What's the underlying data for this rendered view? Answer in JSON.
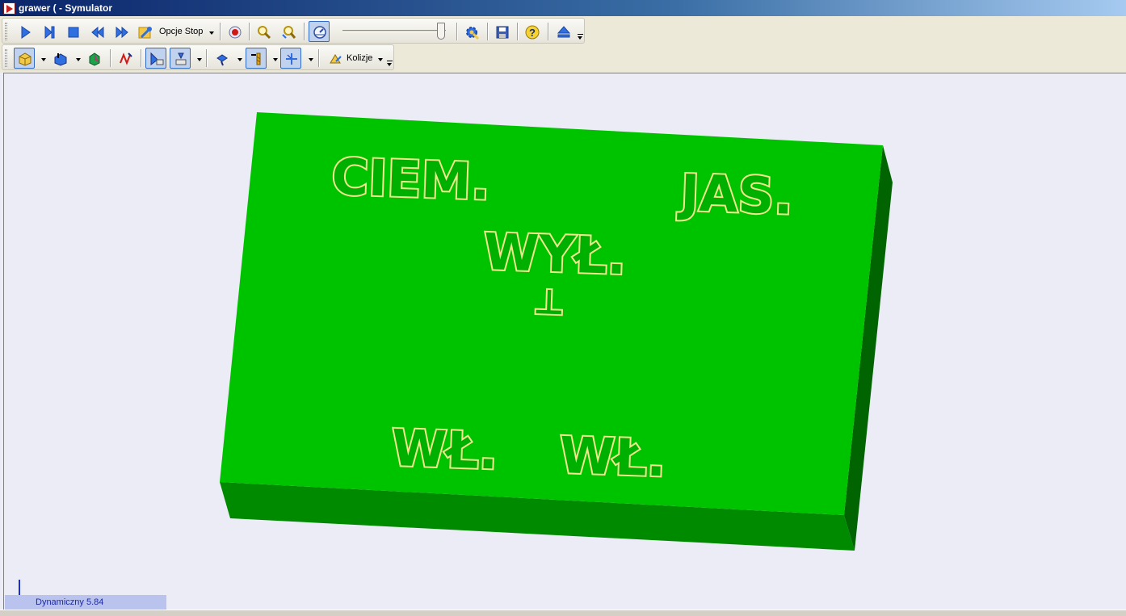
{
  "window": {
    "title": "grawer ( - Symulator"
  },
  "toolbar1": {
    "opcje_stop_label": "Opcje Stop"
  },
  "toolbar2": {
    "kolizje_label": "Kolizje"
  },
  "speed_slider": {
    "value_fraction": 0.95
  },
  "workpiece": {
    "color_top": "#00C300",
    "color_front": "#008A00",
    "color_side": "#006400",
    "engraving_color": "#F0E68C",
    "engravings": [
      "CIEM.",
      "JAS.",
      "WYŁ.",
      "⊥",
      "WŁ.",
      "WŁ."
    ]
  },
  "status": {
    "mode_text": "Dynamiczny 5.84"
  },
  "colors": {
    "accent": "#316AC5",
    "status_bg": "#B9C3EE",
    "title_start": "#0A246A",
    "title_end": "#A6CAF0"
  }
}
